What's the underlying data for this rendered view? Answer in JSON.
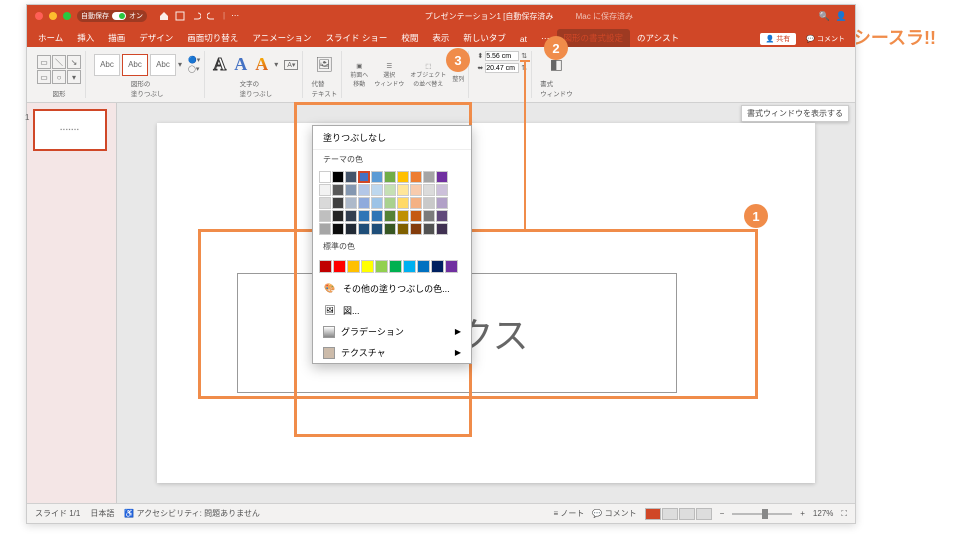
{
  "logo": "シースラ!!",
  "titlebar": {
    "autosave_label": "自動保存",
    "autosave_state": "オン",
    "doc_title": "プレゼンテーション1 [自動保存済み",
    "saved_hint": "Mac に保存済み"
  },
  "tabs": {
    "home": "ホーム",
    "insert": "挿入",
    "draw": "描画",
    "design": "デザイン",
    "transitions": "画面切り替え",
    "animations": "アニメーション",
    "slideshow": "スライド ショー",
    "review": "校閲",
    "view": "表示",
    "new_tab": "新しいタブ",
    "acrobat": "at",
    "shape_format": "図形の書式設定",
    "design_assist": "のアシスト",
    "share": "共有",
    "comments": "コメント"
  },
  "ribbon": {
    "shapes_label": "図形",
    "abc": "Abc",
    "shape_fill_label": "図形の\n塗りつぶし",
    "text_fill_label": "文字の\n塗りつぶし",
    "alt_text": "代替\nテキスト",
    "bring_forward": "前面へ\n移動",
    "selection_pane": "選択\nウィンドウ",
    "align_objects": "オブジェクト\nの並べ替え",
    "align": "整列",
    "height": "5.56 cm",
    "width": "20.47 cm",
    "format_pane": "書式\nウィンドウ"
  },
  "popup": {
    "no_fill": "塗りつぶしなし",
    "theme_colors": "テーマの色",
    "standard_colors": "標準の色",
    "more_fill": "その他の塗りつぶしの色...",
    "picture": "図...",
    "gradient": "グラデーション",
    "texture": "テクスチャ"
  },
  "theme_grid": [
    [
      "#ffffff",
      "#000000",
      "#44546a",
      "#4472c4",
      "#5b9bd5",
      "#70ad47",
      "#ffc000",
      "#ed7d31",
      "#a5a5a5",
      "#7030a0"
    ],
    [
      "#f2f2f2",
      "#595959",
      "#8497b0",
      "#b4c7e7",
      "#bdd7ee",
      "#c5e0b4",
      "#ffe699",
      "#f8cbad",
      "#dbdbdb",
      "#ccc0da"
    ],
    [
      "#d9d9d9",
      "#404040",
      "#adb9ca",
      "#8faadc",
      "#9dc3e6",
      "#a9d18e",
      "#ffd966",
      "#f4b183",
      "#c9c9c9",
      "#b1a0c7"
    ],
    [
      "#bfbfbf",
      "#262626",
      "#333f50",
      "#2e75b6",
      "#2e75b6",
      "#548235",
      "#bf9000",
      "#c55a11",
      "#7b7b7b",
      "#60497a"
    ],
    [
      "#a6a6a6",
      "#0d0d0d",
      "#222a35",
      "#1f4e79",
      "#1f4e79",
      "#385723",
      "#806000",
      "#843c0c",
      "#525252",
      "#403152"
    ]
  ],
  "standard_row": [
    "#c00000",
    "#ff0000",
    "#ffc000",
    "#ffff00",
    "#92d050",
    "#00b050",
    "#00b0f0",
    "#0070c0",
    "#002060",
    "#7030a0"
  ],
  "canvas": {
    "textbox_text": "ボックス"
  },
  "status": {
    "slide_counter": "スライド 1/1",
    "language": "日本語",
    "accessibility": "アクセシビリティ: 問題ありません",
    "notes": "ノート",
    "comments": "コメント",
    "zoom": "127%"
  },
  "tooltip": "書式ウィンドウを表示する",
  "annotations": {
    "a1": "1",
    "a2": "2",
    "a3": "3"
  }
}
